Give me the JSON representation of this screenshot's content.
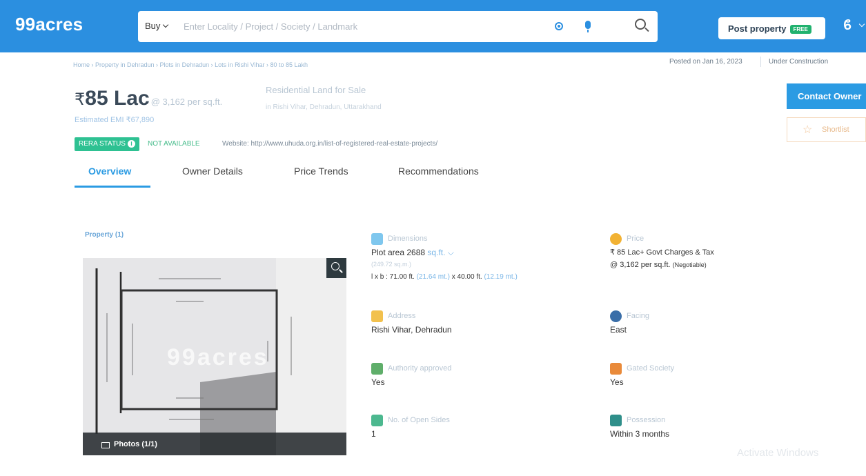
{
  "header": {
    "logo": "99acres",
    "buy_label": "Buy",
    "search_placeholder": "Enter Locality / Project / Society / Landmark",
    "post_property": "Post property",
    "free_badge": "FREE",
    "user_glyph": "ϐ"
  },
  "breadcrumb": "Home › Property in Dehradun › Plots in Dehradun › Lots in Rishi Vihar › 80 to 85 Lakh",
  "meta": {
    "posted": "Posted on Jan 16, 2023",
    "status": "Under Construction"
  },
  "listing": {
    "rupee": "₹",
    "price": "85 Lac",
    "price_per_sqft": "@ 3,162 per sq.ft.",
    "emi": "Estimated EMI ₹67,890",
    "title": "Residential Land for Sale",
    "location": "in Rishi Vihar, Dehradun, Uttarakhand",
    "rera_label": "RERA STATUS",
    "rera_value": "NOT AVAILABLE",
    "website": "Website: http://www.uhuda.org.in/list-of-registered-real-estate-projects/"
  },
  "actions": {
    "contact": "Contact Owner",
    "shortlist": "Shortlist"
  },
  "tabs": [
    {
      "label": "Overview",
      "active": true
    },
    {
      "label": "Owner Details",
      "active": false
    },
    {
      "label": "Price Trends",
      "active": false
    },
    {
      "label": "Recommendations",
      "active": false
    }
  ],
  "gallery": {
    "section_label": "Property (1)",
    "photos_label": "Photos (1/1)",
    "watermark": "99acres"
  },
  "details": {
    "dimensions": {
      "label": "Dimensions",
      "plot_area": "Plot area 2688",
      "unit": "sq.ft.",
      "sub": "(249.72 sq.m.)",
      "lb_prefix": "l x b : 71.00 ft.",
      "lb_m1": "(21.64 mt.)",
      "lb_mid": "x 40.00 ft.",
      "lb_m2": "(12.19 mt.)"
    },
    "price": {
      "label": "Price",
      "value": "₹ 85 Lac+ Govt Charges & Tax",
      "per": "@ 3,162 per sq.ft.",
      "neg": "(Negotiable)"
    },
    "address": {
      "label": "Address",
      "value": "Rishi Vihar, Dehradun"
    },
    "facing": {
      "label": "Facing",
      "value": "East"
    },
    "authority": {
      "label": "Authority approved",
      "value": "Yes"
    },
    "gated": {
      "label": "Gated Society",
      "value": "Yes"
    },
    "open_sides": {
      "label": "No. of Open Sides",
      "value": "1"
    },
    "possession": {
      "label": "Possession",
      "value": "Within 3 months"
    }
  },
  "os_watermark": "Activate Windows",
  "colors": {
    "brand": "#2b8fe0",
    "accent": "#2b9be3",
    "rera_green": "#2ec192"
  }
}
